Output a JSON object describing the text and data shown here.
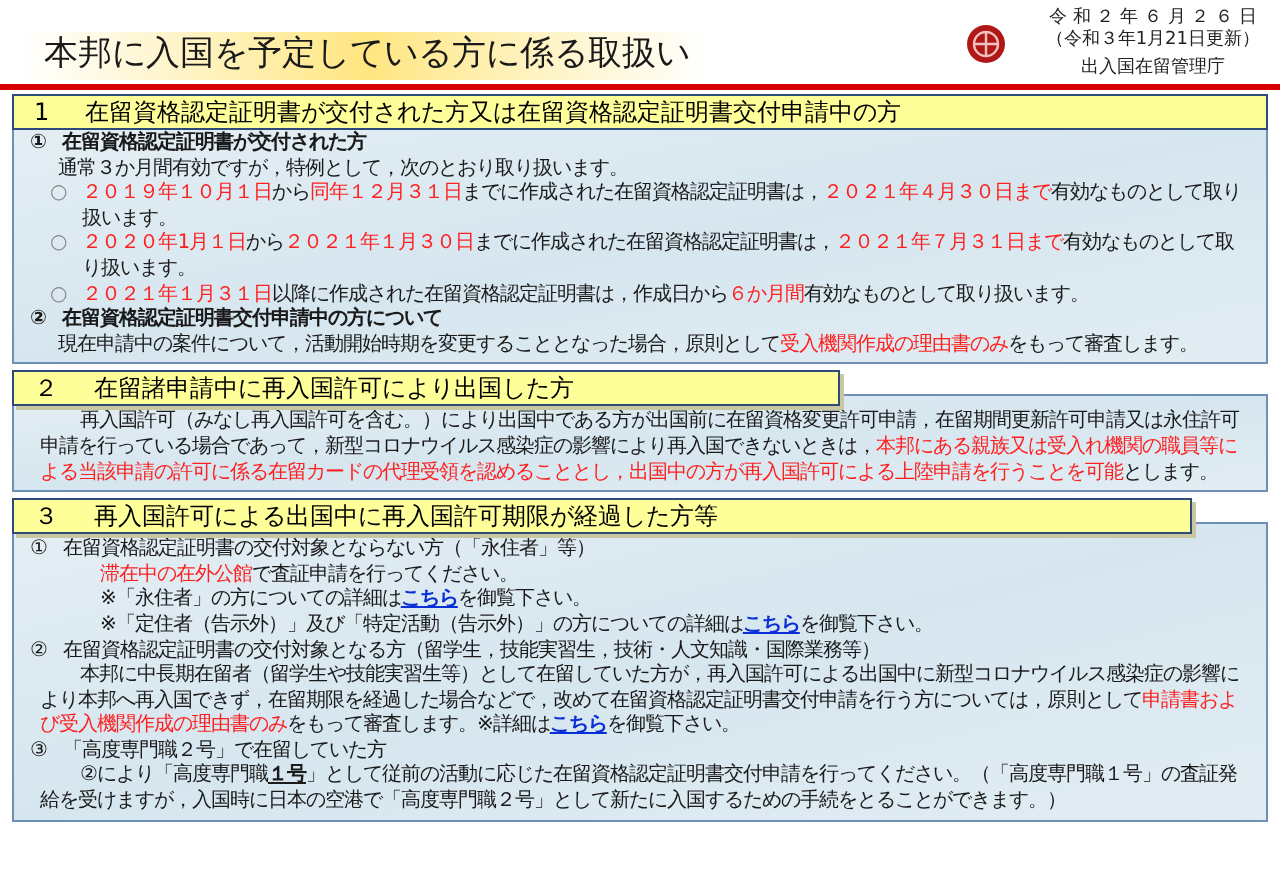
{
  "header": {
    "title": "本邦に入国を予定している方に係る取扱い",
    "date": "令 和 ２ 年 ６ 月 ２ ６ 日",
    "updated": "（令和３年1月21日更新）",
    "agency": "出入国在留管理庁"
  },
  "sections": [
    {
      "number": "1",
      "title": "在留資格認定証明書が交付された方又は在留資格認定証明書交付申請中の方",
      "kind": "full",
      "blocks": [
        {
          "kind": "heading",
          "marker": "①",
          "bold": true,
          "segments": [
            {
              "kind": "plain",
              "text": "在留資格認定証明書が交付された方"
            }
          ]
        },
        {
          "kind": "text",
          "segments": [
            {
              "kind": "plain",
              "text": "通常３か月間有効ですが，特例として，次のとおり取り扱います。"
            }
          ]
        },
        {
          "kind": "bullet",
          "marker": "○",
          "segments": [
            {
              "kind": "emphasis",
              "text": "２０１９年１０月１日"
            },
            {
              "kind": "plain",
              "text": "から"
            },
            {
              "kind": "emphasis",
              "text": "同年１２月３１日"
            },
            {
              "kind": "plain",
              "text": "までに作成された在留資格認定証明書は，"
            },
            {
              "kind": "emphasis",
              "text": "２０２１年４月３０日まで"
            },
            {
              "kind": "plain",
              "text": "有効なものとして取り扱います。"
            }
          ]
        },
        {
          "kind": "bullet",
          "marker": "○",
          "segments": [
            {
              "kind": "emphasis",
              "text": "２０２０年1月１日"
            },
            {
              "kind": "plain",
              "text": "から"
            },
            {
              "kind": "emphasis",
              "text": "２０２１年１月３０日"
            },
            {
              "kind": "plain",
              "text": "までに作成された在留資格認定証明書は，"
            },
            {
              "kind": "emphasis",
              "text": "２０２１年７月３１日まで"
            },
            {
              "kind": "plain",
              "text": "有効なものとして取り扱います。"
            }
          ]
        },
        {
          "kind": "bullet",
          "marker": "○",
          "segments": [
            {
              "kind": "emphasis",
              "text": "２０２１年１月３１日"
            },
            {
              "kind": "plain",
              "text": "以降に作成された在留資格認定証明書は，作成日から"
            },
            {
              "kind": "emphasis",
              "text": "６か月間"
            },
            {
              "kind": "plain",
              "text": "有効なものとして取り扱います。"
            }
          ]
        },
        {
          "kind": "heading",
          "marker": "②",
          "bold": true,
          "segments": [
            {
              "kind": "plain",
              "text": "在留資格認定証明書交付申請中の方について"
            }
          ]
        },
        {
          "kind": "text",
          "segments": [
            {
              "kind": "plain",
              "text": "現在申請中の案件について，活動開始時期を変更することとなった場合，原則として"
            },
            {
              "kind": "emphasis",
              "text": "受入機関作成の理由書のみ"
            },
            {
              "kind": "plain",
              "text": "をもって審査します。"
            }
          ]
        }
      ]
    },
    {
      "number": "２",
      "title": "在留諸申請中に再入国許可により出国した方",
      "kind": "short",
      "blocks": [
        {
          "kind": "indented",
          "segments": [
            {
              "kind": "plain",
              "text": "再入国許可（みなし再入国許可を含む。）により出国中である方が出国前に在留資格変更許可申請，在留期間更新許可申請又は永住許可申請を行っている場合であって，新型コロナウイルス感染症の影響により再入国できないときは，"
            },
            {
              "kind": "emphasis",
              "text": "本邦にある親族又は受入れ機関の職員等による当該申請の許可に係る在留カードの代理受領を認めることとし，出国中の方が再入国許可による上陸申請を行うことを可能"
            },
            {
              "kind": "plain",
              "text": "とします。"
            }
          ]
        }
      ]
    },
    {
      "number": "３",
      "title": "再入国許可による出国中に再入国許可期限が経過した方等",
      "kind": "wide",
      "blocks": [
        {
          "kind": "heading",
          "marker": "①",
          "bold": false,
          "segments": [
            {
              "kind": "plain",
              "text": "在留資格認定証明書の交付対象とならない方（「永住者」等）"
            }
          ]
        },
        {
          "kind": "note",
          "segments": [
            {
              "kind": "emphasis",
              "text": "滞在中の在外公館"
            },
            {
              "kind": "plain",
              "text": "で査証申請を行ってください。"
            }
          ]
        },
        {
          "kind": "note",
          "segments": [
            {
              "kind": "plain",
              "text": "※「永住者」の方についての詳細は"
            },
            {
              "kind": "link",
              "text": "こちら"
            },
            {
              "kind": "plain",
              "text": "を御覧下さい。"
            }
          ]
        },
        {
          "kind": "note",
          "segments": [
            {
              "kind": "plain",
              "text": "※「定住者（告示外）」及び「特定活動（告示外）」の方についての詳細は"
            },
            {
              "kind": "link",
              "text": "こちら"
            },
            {
              "kind": "plain",
              "text": "を御覧下さい。"
            }
          ]
        },
        {
          "kind": "heading",
          "marker": "②",
          "bold": false,
          "segments": [
            {
              "kind": "plain",
              "text": "在留資格認定証明書の交付対象となる方（留学生，技能実習生，技術・人文知識・国際業務等）"
            }
          ]
        },
        {
          "kind": "indented",
          "segments": [
            {
              "kind": "plain",
              "text": "本邦に中長期在留者（留学生や技能実習生等）として在留していた方が，再入国許可による出国中に新型コロナウイルス感染症の影響により本邦へ再入国できず，在留期限を経過した場合などで，改めて在留資格認定証明書交付申請を行う方については，原則として"
            },
            {
              "kind": "emphasis",
              "text": "申請書および受入機関作成の理由書のみ"
            },
            {
              "kind": "plain",
              "text": "をもって審査します。※詳細は"
            },
            {
              "kind": "link",
              "text": "こちら"
            },
            {
              "kind": "plain",
              "text": "を御覧下さい。"
            }
          ]
        },
        {
          "kind": "heading",
          "marker": "③",
          "bold": false,
          "segments": [
            {
              "kind": "plain",
              "text": "「高度専門職２号」で在留していた方"
            }
          ]
        },
        {
          "kind": "indented",
          "segments": [
            {
              "kind": "plain",
              "text": "②により「高度専門職"
            },
            {
              "kind": "strong",
              "text": "１号"
            },
            {
              "kind": "plain",
              "text": "」として従前の活動に応じた在留資格認定証明書交付申請を行ってください。（「高度専門職１号」の査証発給を受けますが，入国時に日本の空港で「高度専門職２号」として新たに入国するための手続をとることができます。）"
            }
          ]
        }
      ]
    }
  ]
}
